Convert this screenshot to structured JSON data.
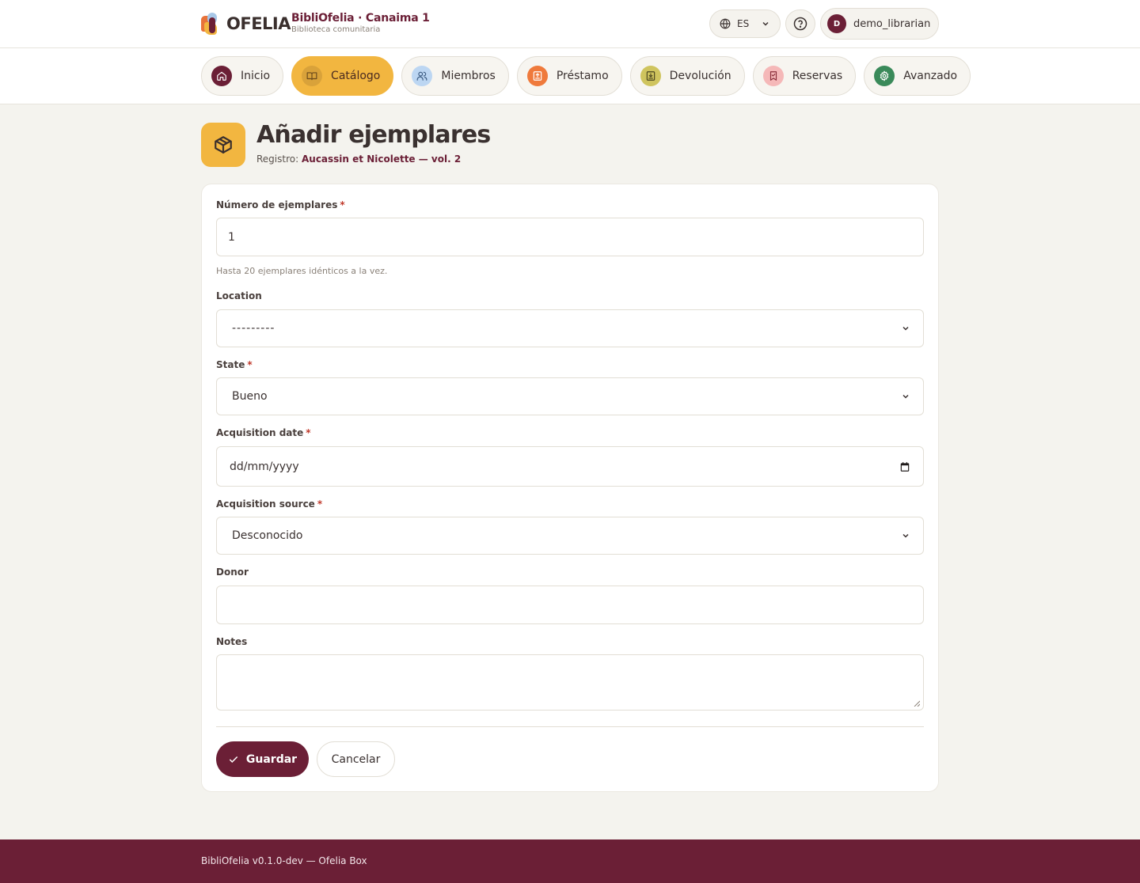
{
  "logo": {
    "wordmark": "OFELIA"
  },
  "brand": {
    "title": "BibliOfelia · Canaima 1",
    "subtitle": "Biblioteca comunitaria"
  },
  "topbar": {
    "language": {
      "value": "ES",
      "icon": "globe-icon"
    },
    "help_icon": "help-circle-icon",
    "user": {
      "initial": "D",
      "name": "demo_librarian"
    }
  },
  "nav": {
    "tabs": [
      {
        "label": "Inicio",
        "icon": "home-icon",
        "icon_bg": "#6b1f36",
        "icon_fg": "#ffffff",
        "active": false
      },
      {
        "label": "Catálogo",
        "icon": "book-icon",
        "icon_bg": "#d9a23a",
        "icon_fg": "#6b4a1c",
        "active": true
      },
      {
        "label": "Miembros",
        "icon": "users-icon",
        "icon_bg": "#bcd6f2",
        "icon_fg": "#3a5a80",
        "active": false
      },
      {
        "label": "Préstamo",
        "icon": "upload-box-icon",
        "icon_bg": "#ef7a3c",
        "icon_fg": "#ffffff",
        "active": false
      },
      {
        "label": "Devolución",
        "icon": "download-box-icon",
        "icon_bg": "#cfc45e",
        "icon_fg": "#4a4420",
        "active": false
      },
      {
        "label": "Reservas",
        "icon": "bookmark-icon",
        "icon_bg": "#f5b8b8",
        "icon_fg": "#8a2e3a",
        "active": false
      },
      {
        "label": "Avanzado",
        "icon": "gear-icon",
        "icon_bg": "#3a8a5a",
        "icon_fg": "#ffffff",
        "active": false
      }
    ]
  },
  "page": {
    "title": "Añadir ejemplares",
    "record_prefix": "Registro:",
    "record_name": "Aucassin et Nicolette — vol. 2",
    "header_icon": "package-icon"
  },
  "form": {
    "copies": {
      "label": "Número de ejemplares",
      "required": "*",
      "value": "1",
      "help": "Hasta 20 ejemplares idénticos a la vez."
    },
    "location": {
      "label": "Location",
      "value": "---------"
    },
    "state": {
      "label": "State",
      "required": "*",
      "value": "Bueno"
    },
    "acq_date": {
      "label": "Acquisition date",
      "required": "*",
      "placeholder": "dd/mm/yyyy"
    },
    "acq_source": {
      "label": "Acquisition source",
      "required": "*",
      "value": "Desconocido"
    },
    "donor": {
      "label": "Donor",
      "value": ""
    },
    "notes": {
      "label": "Notes",
      "value": ""
    },
    "save_label": "Guardar",
    "cancel_label": "Cancelar"
  },
  "footer": {
    "text": "BibliOfelia v0.1.0-dev — Ofelia Box"
  },
  "colors": {
    "brand": "#6b1f36",
    "accent": "#f2b640",
    "background": "#f4f3ee",
    "required": "#c0392b"
  }
}
